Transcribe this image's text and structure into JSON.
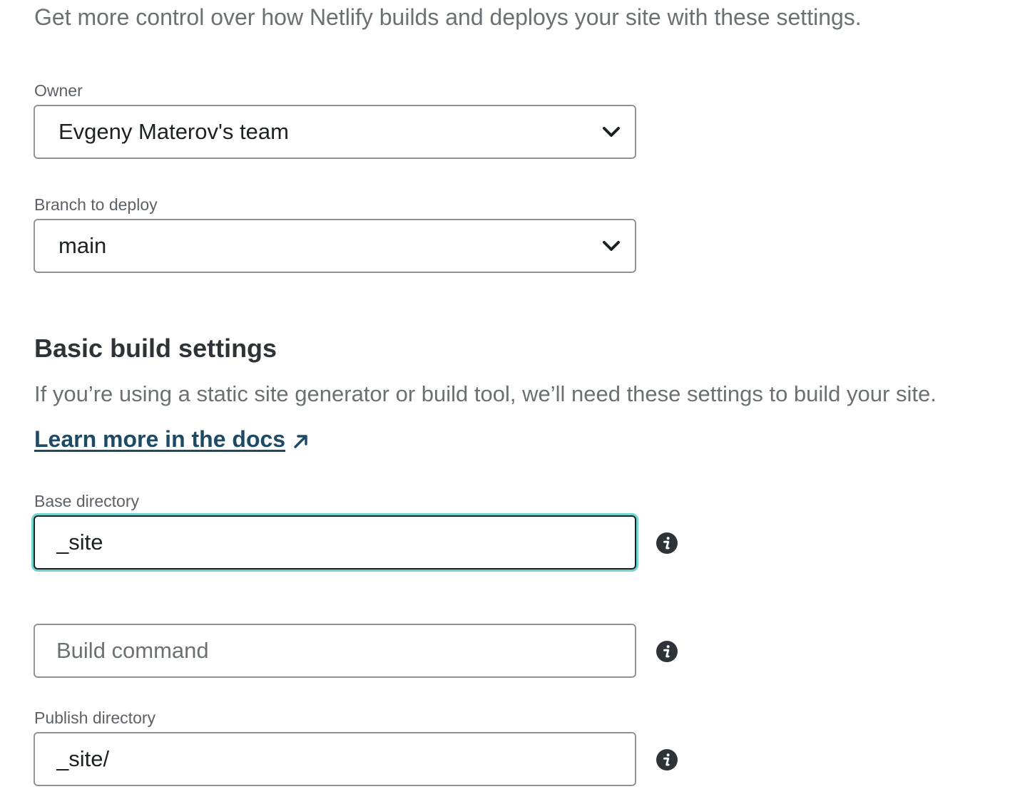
{
  "intro_text": "Get more control over how Netlify builds and deploys your site with these settings.",
  "owner": {
    "label": "Owner",
    "selected": "Evgeny Materov's team"
  },
  "branch": {
    "label": "Branch to deploy",
    "selected": "main"
  },
  "basic_build": {
    "title": "Basic build settings",
    "description": "If you’re using a static site generator or build tool, we’ll need these settings to build your site.",
    "docs_link": "Learn more in the docs"
  },
  "base_directory": {
    "label": "Base directory",
    "value": "_site"
  },
  "build_command": {
    "placeholder": "Build command",
    "value": ""
  },
  "publish_directory": {
    "label": "Publish directory",
    "value": "_site/"
  },
  "icons": {
    "info": "info-icon",
    "chevron": "chevron-down-icon",
    "external": "external-link-icon"
  },
  "colors": {
    "focus_ring": "#6fd6cf",
    "link": "#1e4a64",
    "icon": "#2d3338"
  }
}
